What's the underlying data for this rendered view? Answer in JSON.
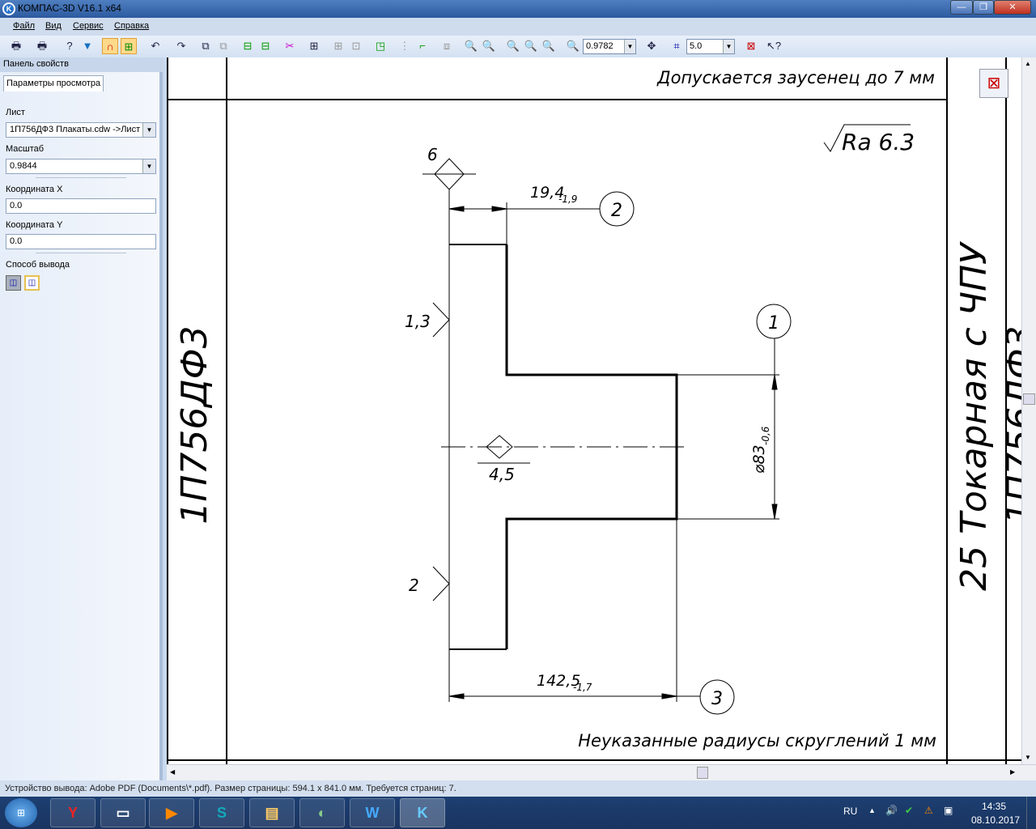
{
  "window": {
    "title": "КОМПАС-3D V16.1 x64",
    "minimize": "—",
    "maximize": "❐",
    "close": "✕"
  },
  "menu": [
    {
      "label": "Файл"
    },
    {
      "label": "Вид"
    },
    {
      "label": "Сервис"
    },
    {
      "label": "Справка"
    }
  ],
  "toolbar": {
    "zoom_value": "0.9782",
    "step_value": "5.0",
    "icons": [
      "print-icon",
      "print-setup-icon",
      "help-pages-icon",
      "filter-icon",
      "magnet-icon",
      "fit-sheet-icon",
      "rotate-left-icon",
      "rotate-right-icon",
      "add-sheet-icon",
      "delete-sheet-icon",
      "move-left-icon",
      "move-right-icon",
      "cut-icon",
      "grid-icon",
      "group-icon",
      "ungroup-icon",
      "place-icon",
      "arrange-icon",
      "origin-icon",
      "align-icon",
      "zoom-in-icon",
      "zoom-out-icon",
      "zoom-window-icon",
      "zoom-plus-icon",
      "zoom-minus-icon",
      "zoom-scale-icon",
      "pan-icon",
      "snap-step-icon",
      "close-preview-icon",
      "context-help-icon"
    ]
  },
  "panel": {
    "title": "Панель свойств",
    "tab": "Параметры просмотра",
    "sheet_label": "Лист",
    "sheet_value": "1П756ДФ3 Плакаты.cdw ->Лист",
    "scale_label": "Масштаб",
    "scale_value": "0.9844",
    "x_label": "Координата X",
    "x_value": "0.0",
    "y_label": "Координата Y",
    "y_value": "0.0",
    "output_label": "Способ вывода"
  },
  "drawing": {
    "note_top": "Допускается заусенец до 7 мм",
    "roughness": "Ra 6.3",
    "left_code": "1П756ДФ3",
    "right_title": "25 Токарная с ЧПУ",
    "right_code_partial": "1П756ДФ3",
    "base_label": "6",
    "dim_top": "19,4",
    "dim_top_tol": "-1,9",
    "dim_bottom": "142,5",
    "dim_bottom_tol": "-1,7",
    "dim_dia": "⌀83",
    "dim_dia_tol": "-0,6",
    "mark_13": "1,3",
    "mark_2": "2",
    "mark_45": "4,5",
    "pos_1": "1",
    "pos_2": "2",
    "pos_3": "3",
    "note_bottom": "Неуказанные радиусы скруглений 1 мм"
  },
  "status": "Устройство вывода: Adobe PDF (Documents\\*.pdf). Размер страницы: 594.1 x 841.0 мм. Требуется страниц: 7.",
  "taskbar": {
    "apps": [
      "yandex-browser",
      "screen-app",
      "media-player",
      "skype",
      "file-explorer",
      "media-center",
      "word",
      "kompas-3d"
    ],
    "lang": "RU",
    "time": "14:35",
    "date": "08.10.2017"
  }
}
